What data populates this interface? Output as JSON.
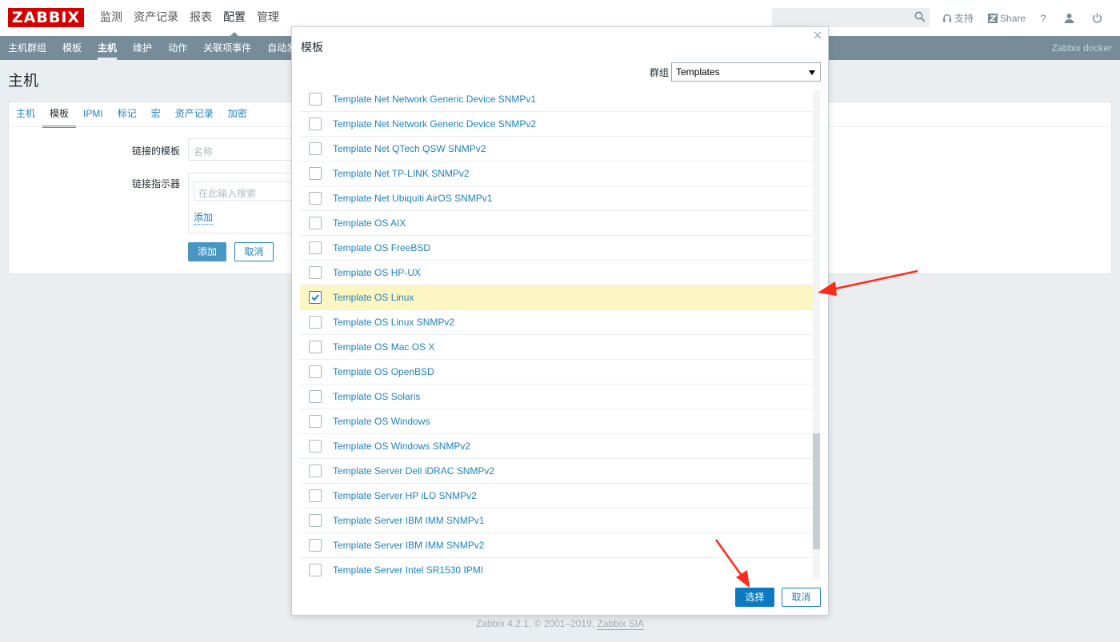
{
  "app": {
    "logo": "ZABBIX",
    "main_menu": [
      "监测",
      "资产记录",
      "报表",
      "配置",
      "管理"
    ],
    "main_menu_active": "配置",
    "search_placeholder": "",
    "support_label": "支持",
    "share_label": "Share",
    "help_label": "?",
    "sub_menu": [
      "主机群组",
      "模板",
      "主机",
      "维护",
      "动作",
      "关联项事件",
      "自动发"
    ],
    "sub_menu_active": "主机",
    "server_name": "Zabbix docker"
  },
  "page": {
    "title": "主机",
    "tabs": [
      "主机",
      "模板",
      "IPMI",
      "标记",
      "宏",
      "资产记录",
      "加密"
    ],
    "active_tab": "模板",
    "form": {
      "linked_templates_label": "链接的模板",
      "linked_templates_placeholder": "名称",
      "link_indicator_label": "链接指示器",
      "link_search_placeholder": "在此输入搜索",
      "add_link": "添加",
      "add_button": "添加",
      "cancel_button": "取消"
    },
    "footer": {
      "text": "Zabbix 4.2.1. © 2001–2019, ",
      "link": "Zabbix SIA"
    }
  },
  "modal": {
    "title": "模板",
    "group_label": "群组",
    "group_selected": "Templates",
    "templates": [
      {
        "name": "Template Net Network Generic Device SNMPv1",
        "checked": false
      },
      {
        "name": "Template Net Network Generic Device SNMPv2",
        "checked": false
      },
      {
        "name": "Template Net QTech QSW SNMPv2",
        "checked": false
      },
      {
        "name": "Template Net TP-LINK SNMPv2",
        "checked": false
      },
      {
        "name": "Template Net Ubiquiti AirOS SNMPv1",
        "checked": false
      },
      {
        "name": "Template OS AIX",
        "checked": false
      },
      {
        "name": "Template OS FreeBSD",
        "checked": false
      },
      {
        "name": "Template OS HP-UX",
        "checked": false
      },
      {
        "name": "Template OS Linux",
        "checked": true
      },
      {
        "name": "Template OS Linux SNMPv2",
        "checked": false
      },
      {
        "name": "Template OS Mac OS X",
        "checked": false
      },
      {
        "name": "Template OS OpenBSD",
        "checked": false
      },
      {
        "name": "Template OS Solaris",
        "checked": false
      },
      {
        "name": "Template OS Windows",
        "checked": false
      },
      {
        "name": "Template OS Windows SNMPv2",
        "checked": false
      },
      {
        "name": "Template Server Dell iDRAC SNMPv2",
        "checked": false
      },
      {
        "name": "Template Server HP iLO SNMPv2",
        "checked": false
      },
      {
        "name": "Template Server IBM IMM SNMPv1",
        "checked": false
      },
      {
        "name": "Template Server IBM IMM SNMPv2",
        "checked": false
      },
      {
        "name": "Template Server Intel SR1530 IPMI",
        "checked": false
      }
    ],
    "select_button": "选择",
    "cancel_button": "取消"
  },
  "colors": {
    "brand": "#d40000",
    "link": "#1f82c0",
    "subnav": "#768d99",
    "selected_row": "#fcf7c2",
    "annotation_arrow": "#ff2a1a"
  }
}
